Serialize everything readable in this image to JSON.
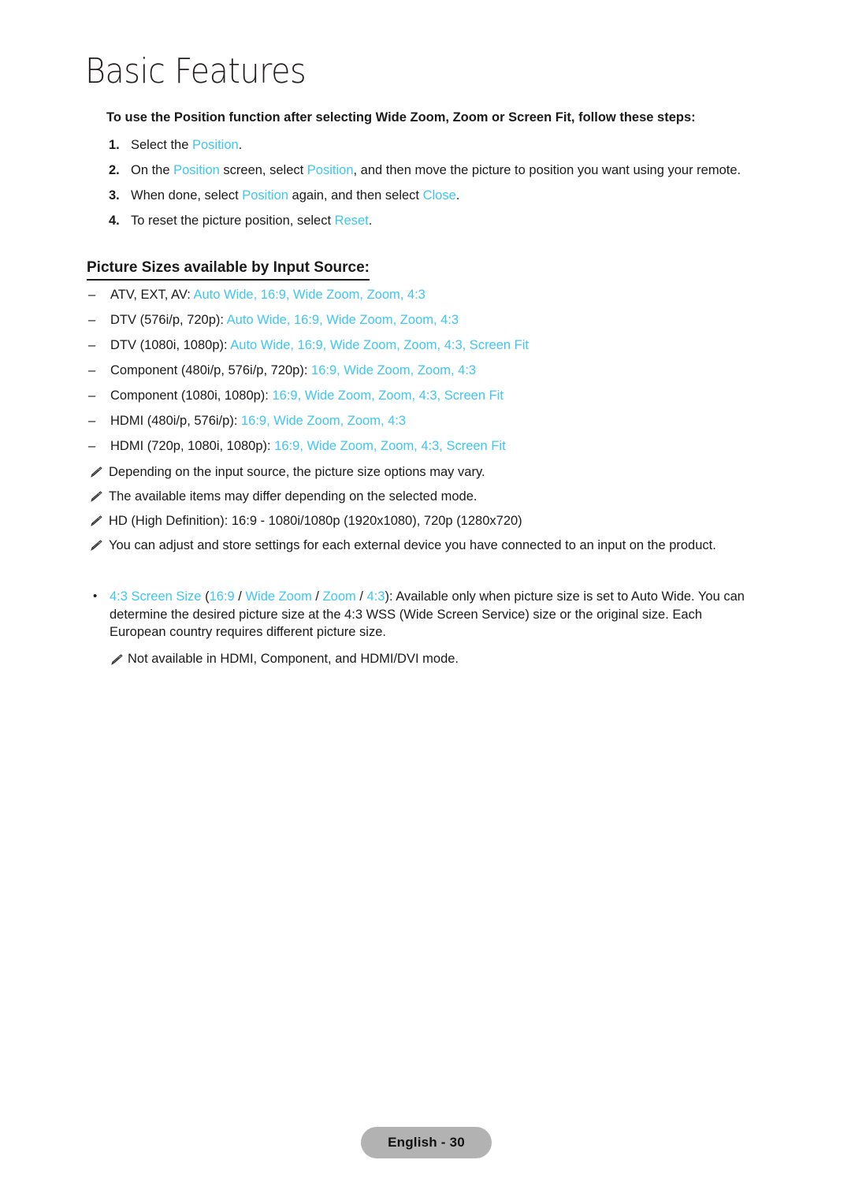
{
  "page": {
    "chapter_title": "Basic Features",
    "footer_label": "English - 30",
    "accent_color": "#3ec6f5",
    "text_color": "#1a1a1a",
    "footer_badge_color": "#b2b2b2"
  },
  "intro": {
    "line": "To use the Position function after selecting Wide Zoom, Zoom or Screen Fit, follow these steps:"
  },
  "steps": [
    {
      "number": "1.",
      "parts": [
        {
          "text": "Select the ",
          "style": "plain"
        },
        {
          "text": "Position",
          "style": "accent"
        },
        {
          "text": ".",
          "style": "plain"
        }
      ]
    },
    {
      "number": "2.",
      "parts": [
        {
          "text": "On the ",
          "style": "plain"
        },
        {
          "text": "Position",
          "style": "accent"
        },
        {
          "text": " screen, select ",
          "style": "plain"
        },
        {
          "text": "Position",
          "style": "accent"
        },
        {
          "text": ", and then move the picture to position you want using your remote.",
          "style": "plain"
        }
      ]
    },
    {
      "number": "3.",
      "parts": [
        {
          "text": "When done, select ",
          "style": "plain"
        },
        {
          "text": "Position",
          "style": "accent"
        },
        {
          "text": " again, and then select ",
          "style": "plain"
        },
        {
          "text": "Close",
          "style": "accent"
        },
        {
          "text": ".",
          "style": "plain"
        }
      ]
    },
    {
      "number": "4.",
      "parts": [
        {
          "text": "To reset the picture position, select ",
          "style": "plain"
        },
        {
          "text": "Reset",
          "style": "accent"
        },
        {
          "text": ".",
          "style": "plain"
        }
      ]
    }
  ],
  "section": {
    "heading": "Picture Sizes available by Input Source:",
    "items": [
      {
        "dash": "–",
        "parts": [
          {
            "text": "ATV, EXT, AV: ",
            "style": "plain"
          },
          {
            "text": "Auto Wide, 16:9, Wide Zoom, Zoom, 4:3",
            "style": "accent"
          }
        ]
      },
      {
        "dash": "–",
        "parts": [
          {
            "text": "DTV (576i/p, 720p): ",
            "style": "plain"
          },
          {
            "text": "Auto Wide, 16:9, Wide Zoom, Zoom, 4:3",
            "style": "accent"
          }
        ]
      },
      {
        "dash": "–",
        "parts": [
          {
            "text": "DTV (1080i, 1080p): ",
            "style": "plain"
          },
          {
            "text": "Auto Wide, 16:9, Wide Zoom, Zoom, 4:3, Screen Fit",
            "style": "accent"
          }
        ]
      },
      {
        "dash": "–",
        "parts": [
          {
            "text": "Component (480i/p, 576i/p, 720p): ",
            "style": "plain"
          },
          {
            "text": "16:9, Wide Zoom, Zoom, 4:3",
            "style": "accent"
          }
        ]
      },
      {
        "dash": "–",
        "parts": [
          {
            "text": "Component (1080i, 1080p): ",
            "style": "plain"
          },
          {
            "text": "16:9, Wide Zoom, Zoom, 4:3, Screen Fit",
            "style": "accent"
          }
        ]
      },
      {
        "dash": "–",
        "parts": [
          {
            "text": "HDMI (480i/p, 576i/p): ",
            "style": "plain"
          },
          {
            "text": "16:9, Wide Zoom, Zoom, 4:3",
            "style": "accent"
          }
        ]
      },
      {
        "dash": "–",
        "parts": [
          {
            "text": "HDMI (720p, 1080i, 1080p): ",
            "style": "plain"
          },
          {
            "text": "16:9, Wide Zoom, Zoom, 4:3, Screen Fit",
            "style": "accent"
          }
        ]
      }
    ]
  },
  "notes": [
    {
      "icon": "pencil-note-icon",
      "text": "Depending on the input source, the picture size options may vary."
    },
    {
      "icon": "pencil-note-icon",
      "text": "The available items may differ depending on the selected mode."
    },
    {
      "icon": "pencil-note-icon",
      "text": "HD (High Definition): 16:9 - 1080i/1080p (1920x1080), 720p (1280x720)"
    },
    {
      "icon": "pencil-note-icon",
      "text": "You can adjust and store settings for each external device you have connected to an input on the product."
    }
  ],
  "bullet_block": {
    "bullet": "•",
    "parts": [
      {
        "text": "4:3 Screen Size",
        "style": "accent"
      },
      {
        "text": " (",
        "style": "plain"
      },
      {
        "text": "16:9",
        "style": "accent"
      },
      {
        "text": " / ",
        "style": "plain"
      },
      {
        "text": "Wide Zoom",
        "style": "accent"
      },
      {
        "text": " / ",
        "style": "plain"
      },
      {
        "text": "Zoom",
        "style": "accent"
      },
      {
        "text": " / ",
        "style": "plain"
      },
      {
        "text": "4:3",
        "style": "accent"
      },
      {
        "text": "): Available only when picture size is set to Auto Wide. You can determine the desired picture size at the 4:3 WSS (Wide Screen Service) size or the original size. Each European country requires different picture size.",
        "style": "plain"
      }
    ],
    "note": {
      "icon": "pencil-note-icon",
      "text": "Not available in HDMI, Component, and HDMI/DVI mode."
    }
  }
}
